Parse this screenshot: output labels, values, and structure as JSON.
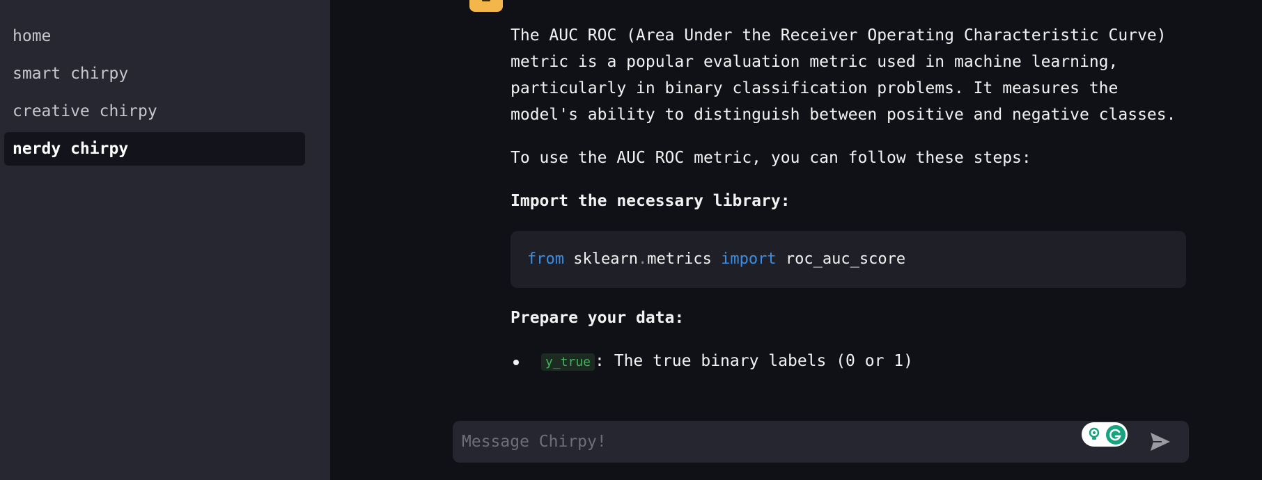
{
  "sidebar": {
    "items": [
      {
        "label": "home",
        "active": false
      },
      {
        "label": "smart chirpy",
        "active": false
      },
      {
        "label": "creative chirpy",
        "active": false
      },
      {
        "label": "nerdy chirpy",
        "active": true
      }
    ]
  },
  "message": {
    "intro": "The AUC ROC (Area Under the Receiver Operating Characteristic Curve) metric is a popular evaluation metric used in machine learning, particularly in binary classification problems. It measures the model's ability to distinguish between positive and negative classes.",
    "steps_intro": "To use the AUC ROC metric, you can follow these steps:",
    "step1_heading": "Import the necessary library:",
    "code": {
      "kw_from": "from",
      "module": "sklearn",
      "dot": ".",
      "submodule": "metrics",
      "kw_import": "import",
      "name": "roc_auc_score"
    },
    "step2_heading": "Prepare your data:",
    "bullets": [
      {
        "code": "y_true",
        "text": ": The true binary labels (0 or 1)"
      }
    ]
  },
  "composer": {
    "placeholder": "Message Chirpy!"
  },
  "colors": {
    "sidebar_bg": "#272731",
    "main_bg": "#0f1117",
    "keyword": "#3a8ee6",
    "inline_code": "#3fb45a",
    "avatar": "#f2b64a",
    "grammarly": "#16a37f"
  },
  "icons": {
    "avatar": "chirpy-avatar-icon",
    "grammarly_bulb": "lightbulb-icon",
    "grammarly": "grammarly-icon",
    "send": "send-icon"
  }
}
